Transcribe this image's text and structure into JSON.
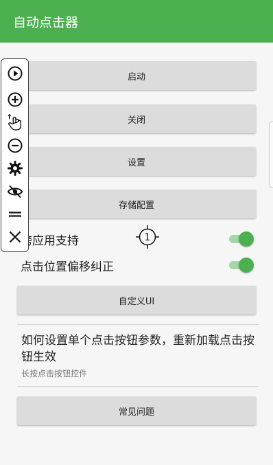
{
  "app_bar": {
    "title": "自动点击器",
    "color": "#4caf50"
  },
  "buttons": {
    "start": "启动",
    "close": "关闭",
    "settings": "设置",
    "save_config": "存储配置",
    "custom_ui": "自定义UI",
    "faq": "常见问题"
  },
  "toggles": [
    {
      "label": "跨应用支持",
      "on": true
    },
    {
      "label": "点击位置偏移纠正",
      "on": true
    }
  ],
  "help": {
    "title": "如何设置单个点击按钮参数，重新加载点击按钮生效",
    "subtitle": "长按点击按钮控件"
  },
  "floating_toolbar": {
    "icons": [
      "play-icon",
      "add-icon",
      "tap-gesture-icon",
      "remove-icon",
      "gear-icon",
      "eye-off-icon",
      "drag-handle-icon",
      "close-icon"
    ]
  },
  "click_target": {
    "number": "1"
  }
}
